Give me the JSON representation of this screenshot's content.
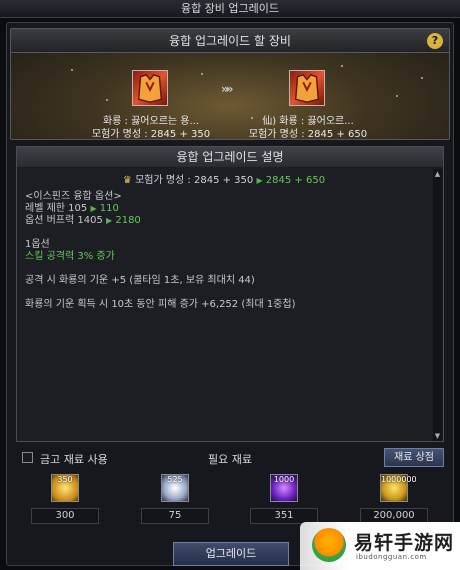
{
  "window": {
    "title": "융합 장비 업그레이드"
  },
  "top_panel": {
    "title": "융합 업그레이드 할 장비",
    "help_label": "?",
    "source_item": {
      "name": "화룡 : 끓어오르는 용...",
      "score": "모험가 명성 : 2845 + 350"
    },
    "arrow": "»»",
    "target_item": {
      "name": "仙) 화룡 : 끓어오르...",
      "score": "모험가 명성 : 2845 + 650"
    }
  },
  "description": {
    "title": "융합 업그레이드 설명",
    "score_prefix": "모험가 명성 : 2845 + 350",
    "score_arrow": "▶",
    "score_new": "2845 + 650",
    "lines": {
      "option_header": "<이스핀즈 융합 옵션>",
      "level_label": "레벨 제한 105",
      "level_arrow": "▶",
      "level_new": "110",
      "buff_label": "옵션 버프력 1405",
      "buff_arrow": "▶",
      "buff_new": "2180",
      "opt1": "1옵션",
      "skill": "스킬 공격력 3% 증가",
      "attack": "공격 시 화룡의 기운 +5 (쿨타임 1초, 보유 최대치 44)",
      "dmg": "화룡의 기운 획득 시 10초 동안 피해 증가 +6,252 (최대 1중첩)"
    }
  },
  "materials": {
    "use_vault_label": "금고 재료 사용",
    "title": "필요 재료",
    "shop_label": "재료 상점",
    "items": [
      {
        "badge": "350",
        "count": "300",
        "icon": "gold-crystal-icon"
      },
      {
        "badge": "525",
        "count": "75",
        "icon": "white-orb-icon"
      },
      {
        "badge": "1000",
        "count": "351",
        "icon": "purple-orb-icon"
      },
      {
        "badge": "1000000",
        "count": "200,000",
        "icon": "gold-coins-icon"
      }
    ]
  },
  "upgrade_label": "업그레이드",
  "watermark": {
    "text": "易轩手游网",
    "url": "ibudongguan.com"
  }
}
